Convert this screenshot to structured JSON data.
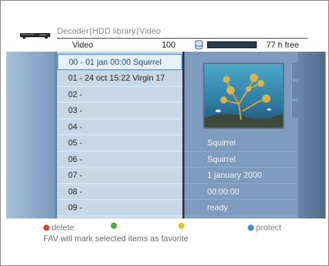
{
  "header": {
    "breadcrumb": [
      "Decoder",
      "HDD library",
      "Video"
    ],
    "column_title": "Video",
    "count": "100",
    "free_space": "77 h free"
  },
  "list": {
    "selected_index": 0,
    "items": [
      "00 - 01 jan 00:00 Squirrel",
      "01 - 24 oct 15:22 Virgin 17",
      "02 -",
      "03 -",
      "04 -",
      "05 -",
      "06 -",
      "07 -",
      "08 -",
      "09 -"
    ]
  },
  "details": {
    "title": "Squirrel",
    "channel": "Squirrel",
    "date": "1 january 2000",
    "duration": "00:00:00",
    "status": "ready"
  },
  "footer": {
    "keys": [
      {
        "color": "#d64b2a",
        "label": "delete",
        "icon": "red-key-icon"
      },
      {
        "color": "#3fae3a",
        "label": "",
        "icon": "green-key-icon"
      },
      {
        "color": "#e3c51f",
        "label": "",
        "icon": "yellow-key-icon"
      },
      {
        "color": "#3f8fd8",
        "label": "protect",
        "icon": "blue-key-icon"
      }
    ],
    "hint": "FAV will mark selected items as favorite"
  }
}
